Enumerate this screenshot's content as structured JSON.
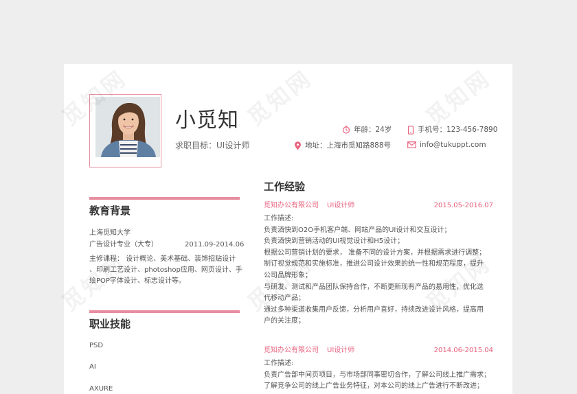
{
  "watermark": "觅知网",
  "profile": {
    "name": "小觅知",
    "objective": "求职目标：UI设计师",
    "age": "年龄：24岁",
    "phone": "手机号：123-456-7890",
    "address": "地址：上海市觅知路888号",
    "email": "info@tukuppt.com"
  },
  "education": {
    "title": "教育背景",
    "school": "上海觅知大学",
    "major": "广告设计专业（大专）",
    "period": "2011.09-2014.06",
    "courses": [
      "主修课程： 设计概论、美术基础、装饰招贴设计",
      "、印刷工艺设计、photoshop应用、网页设计、手",
      "绘POP字体设计、标志设计等。"
    ]
  },
  "skills": {
    "title": "职业技能",
    "items": [
      "PSD",
      "AI",
      "AXURE"
    ]
  },
  "work": {
    "title": "工作经验",
    "jobs": [
      {
        "company": "觅知办公有限公司",
        "role": "UI设计师",
        "period": "2015.05-2016.07",
        "lines": [
          "工作描述:",
          "负责酒快到O2O手机客户端、网站产品的UI设计和交互设计；",
          "负责酒快到营销活动的UI视觉设计和H5设计；",
          "根据公司营销计划的要求， 准备不同的设计方案，并根据需求进行调整；",
          "制订视觉规范和实施标准，推进公司设计效果的统一性和规范程度，提升",
          "公司品牌形象；",
          "与研发、测试和产品团队保持合作，不断更新现有产品的易用性，优化迭",
          "代移动产品；",
          "通过多种渠道收集用户反馈，分析用户喜好，持续改进设计风格，提高用",
          "户的关注度；"
        ]
      },
      {
        "company": "觅知办公有限公司",
        "role": "UI设计师",
        "period": "2014.06-2015.04",
        "lines": [
          "工作描述:",
          "负责广告部中间页项目，与市场部同事密切合作，了解公司线上推广需求；",
          "了解竞争公司的线上广告业务特征，对本公司的线上广告进行不断改进；"
        ]
      }
    ]
  },
  "colors": {
    "accent": "#e88ea0",
    "accent_text": "#e8627e"
  }
}
